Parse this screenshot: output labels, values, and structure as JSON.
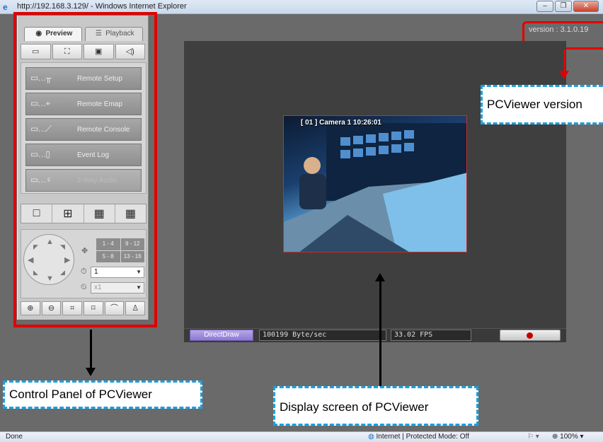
{
  "window": {
    "title": "http://192.168.3.129/ - Windows Internet Explorer",
    "buttons": [
      "–",
      "❐",
      "✕"
    ]
  },
  "version_text": "version : 3.1.0.19",
  "control_panel": {
    "tabs": {
      "preview": "Preview",
      "playback": "Playback"
    },
    "toolbar_icons": [
      "snapshot-icon",
      "fullscreen-icon",
      "record-icon",
      "audio-icon"
    ],
    "functions": [
      {
        "label": "Remote Setup",
        "enabled": true
      },
      {
        "label": "Remote Emap",
        "enabled": true
      },
      {
        "label": "Remote Console",
        "enabled": true
      },
      {
        "label": "Event Log",
        "enabled": true
      },
      {
        "label": "2-Way Audio",
        "enabled": false
      }
    ],
    "layouts": [
      "1x1",
      "2x2",
      "3x3",
      "4x4"
    ],
    "ptz": {
      "channel_groups": [
        "1 - 4",
        "9 - 12",
        "5 - 8",
        "13 - 16"
      ],
      "speed_select": "1",
      "zoom_select": "x1"
    }
  },
  "display": {
    "camera_label": "[ 01 ] Camera 1 10:26:01",
    "render_mode": "DirectDraw",
    "bitrate": "100199 Byte/sec",
    "fps": "33.02 FPS"
  },
  "annotations": {
    "control_panel": "Control Panel of PCViewer",
    "display_screen": "Display screen of PCViewer",
    "version": "PCViewer version"
  },
  "statusbar": {
    "left": "Done",
    "zone": "Internet | Protected Mode: Off",
    "zoom": "100%"
  },
  "colors": {
    "highlight_red": "#e00000",
    "callout_blue": "#1aa0e0"
  }
}
